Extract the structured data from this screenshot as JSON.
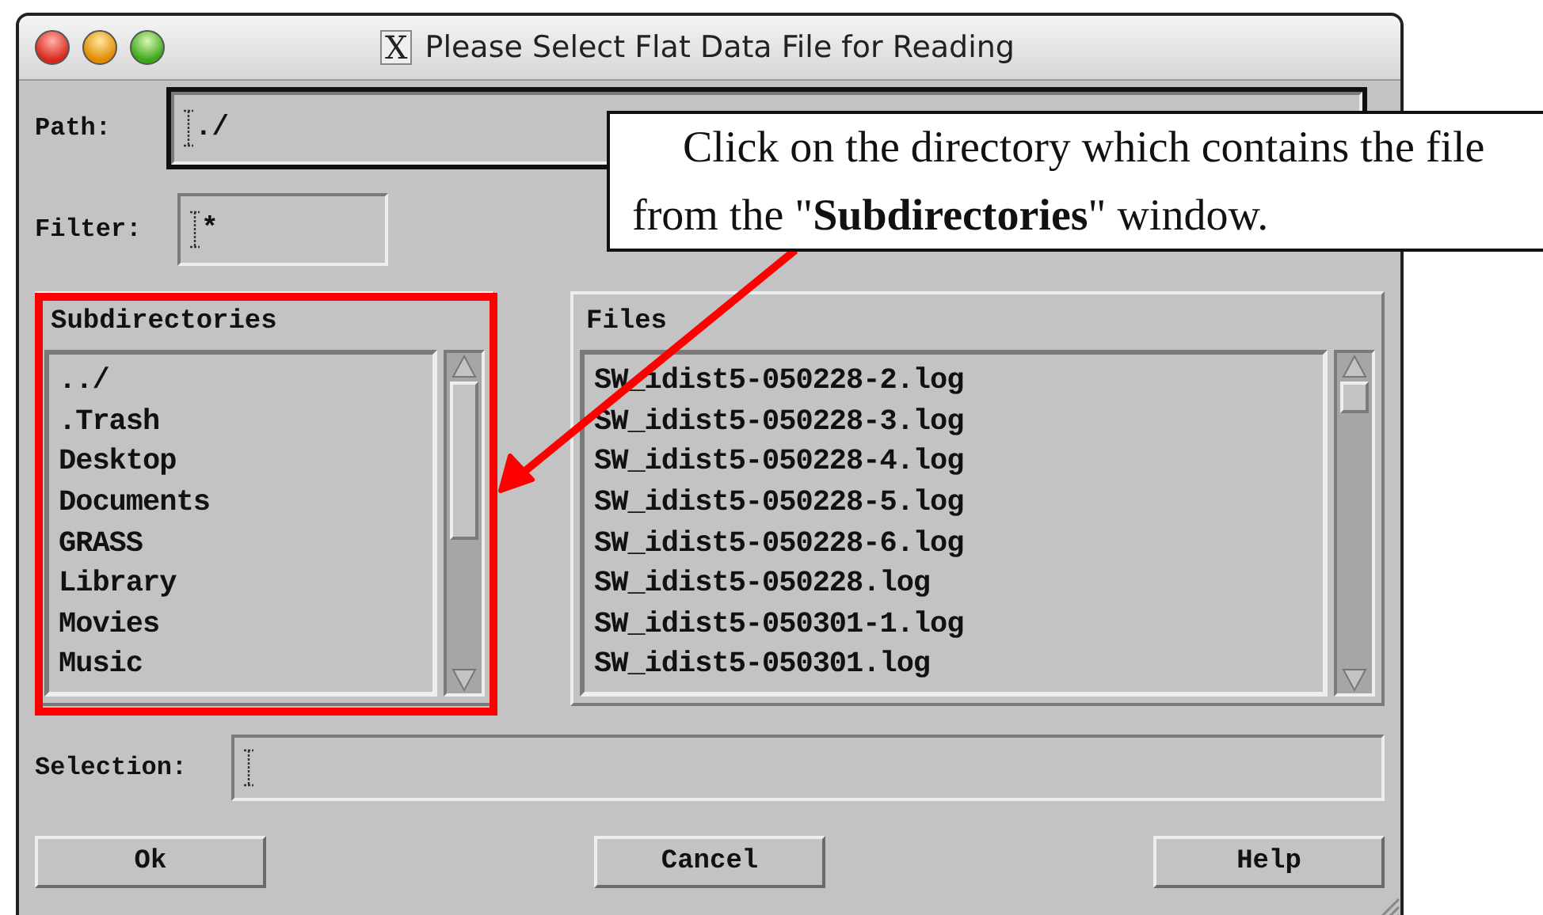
{
  "window": {
    "title_icon": "X",
    "title": "Please Select Flat Data File for Reading"
  },
  "path": {
    "label": "Path:",
    "value": "./",
    "focused": true
  },
  "filter": {
    "label": "Filter:",
    "value": "*",
    "focused": false
  },
  "subdirectories": {
    "title": "Subdirectories",
    "highlighted": true,
    "items": [
      "../",
      ".Trash",
      "Desktop",
      "Documents",
      "GRASS",
      "Library",
      "Movies",
      "Music"
    ]
  },
  "files": {
    "title": "Files",
    "items": [
      "SW_idist5-050228-2.log",
      "SW_idist5-050228-3.log",
      "SW_idist5-050228-4.log",
      "SW_idist5-050228-5.log",
      "SW_idist5-050228-6.log",
      "SW_idist5-050228.log",
      "SW_idist5-050301-1.log",
      "SW_idist5-050301.log"
    ]
  },
  "selection": {
    "label": "Selection:",
    "focused": false
  },
  "buttons": [
    "Ok",
    "Cancel",
    "Help"
  ],
  "callout": {
    "text": "Click on the directory which contains the file from the \"**Subdirectories**\" window."
  }
}
